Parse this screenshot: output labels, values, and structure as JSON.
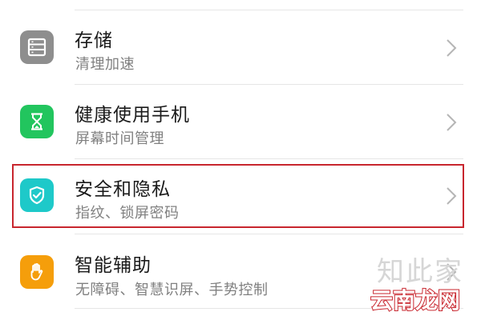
{
  "settings": {
    "items": [
      {
        "title": "存储",
        "subtitle": "清理加速",
        "icon": "storage-icon",
        "icon_color": "#8e8e8e"
      },
      {
        "title": "健康使用手机",
        "subtitle": "屏幕时间管理",
        "icon": "hourglass-icon",
        "icon_color": "#22c55e"
      },
      {
        "title": "安全和隐私",
        "subtitle": "指纹、锁屏密码",
        "icon": "shield-check-icon",
        "icon_color": "#1ec9c9"
      },
      {
        "title": "智能辅助",
        "subtitle": "无障碍、智慧识屏、手势控制",
        "icon": "hand-icon",
        "icon_color": "#f59e0b"
      }
    ],
    "highlight_color": "#c8262e"
  },
  "watermark": {
    "line1": "知此家",
    "line2": "云南龙网"
  }
}
